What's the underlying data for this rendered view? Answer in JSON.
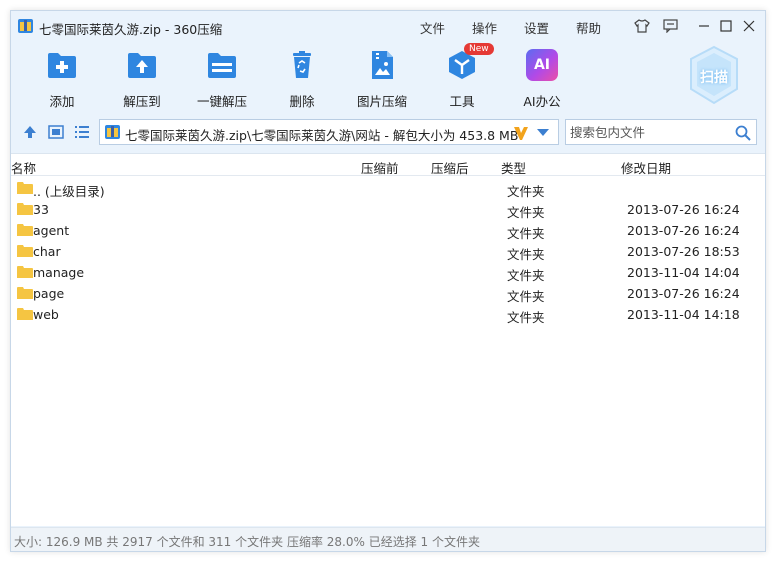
{
  "window": {
    "title": "七零国际莱茵久游.zip - 360压缩"
  },
  "menu": {
    "file": "文件",
    "operate": "操作",
    "settings": "设置",
    "help": "帮助"
  },
  "toolbar": {
    "add": "添加",
    "extract_to": "解压到",
    "one_click_extract": "一键解压",
    "delete": "删除",
    "image_compress": "图片压缩",
    "tools": "工具",
    "tools_badge": "New",
    "ai_office": "AI办公",
    "ai_icon_text": "AI",
    "scan": "扫描"
  },
  "address": {
    "path": "七零国际莱茵久游.zip\\七零国际莱茵久游\\网站 - 解包大小为 453.8 MB"
  },
  "search": {
    "placeholder": "搜索包内文件"
  },
  "columns": {
    "name": "名称",
    "compressed_before": "压缩前",
    "compressed_after": "压缩后",
    "type": "类型",
    "modified": "修改日期"
  },
  "files": [
    {
      "name": ".. (上级目录)",
      "type": "文件夹",
      "date": ""
    },
    {
      "name": "33",
      "type": "文件夹",
      "date": "2013-07-26 16:24"
    },
    {
      "name": "agent",
      "type": "文件夹",
      "date": "2013-07-26 16:24"
    },
    {
      "name": "char",
      "type": "文件夹",
      "date": "2013-07-26 18:53"
    },
    {
      "name": "manage",
      "type": "文件夹",
      "date": "2013-11-04 14:04"
    },
    {
      "name": "page",
      "type": "文件夹",
      "date": "2013-07-26 16:24"
    },
    {
      "name": "web",
      "type": "文件夹",
      "date": "2013-11-04 14:18"
    }
  ],
  "status": {
    "text": "大小: 126.9 MB 共 2917 个文件和 311 个文件夹 压缩率 28.0% 已经选择 1 个文件夹"
  },
  "colors": {
    "accent": "#2f86e0",
    "folder": "#f5c542",
    "window_bg": "#eaf3fc",
    "badge": "#e53935"
  }
}
